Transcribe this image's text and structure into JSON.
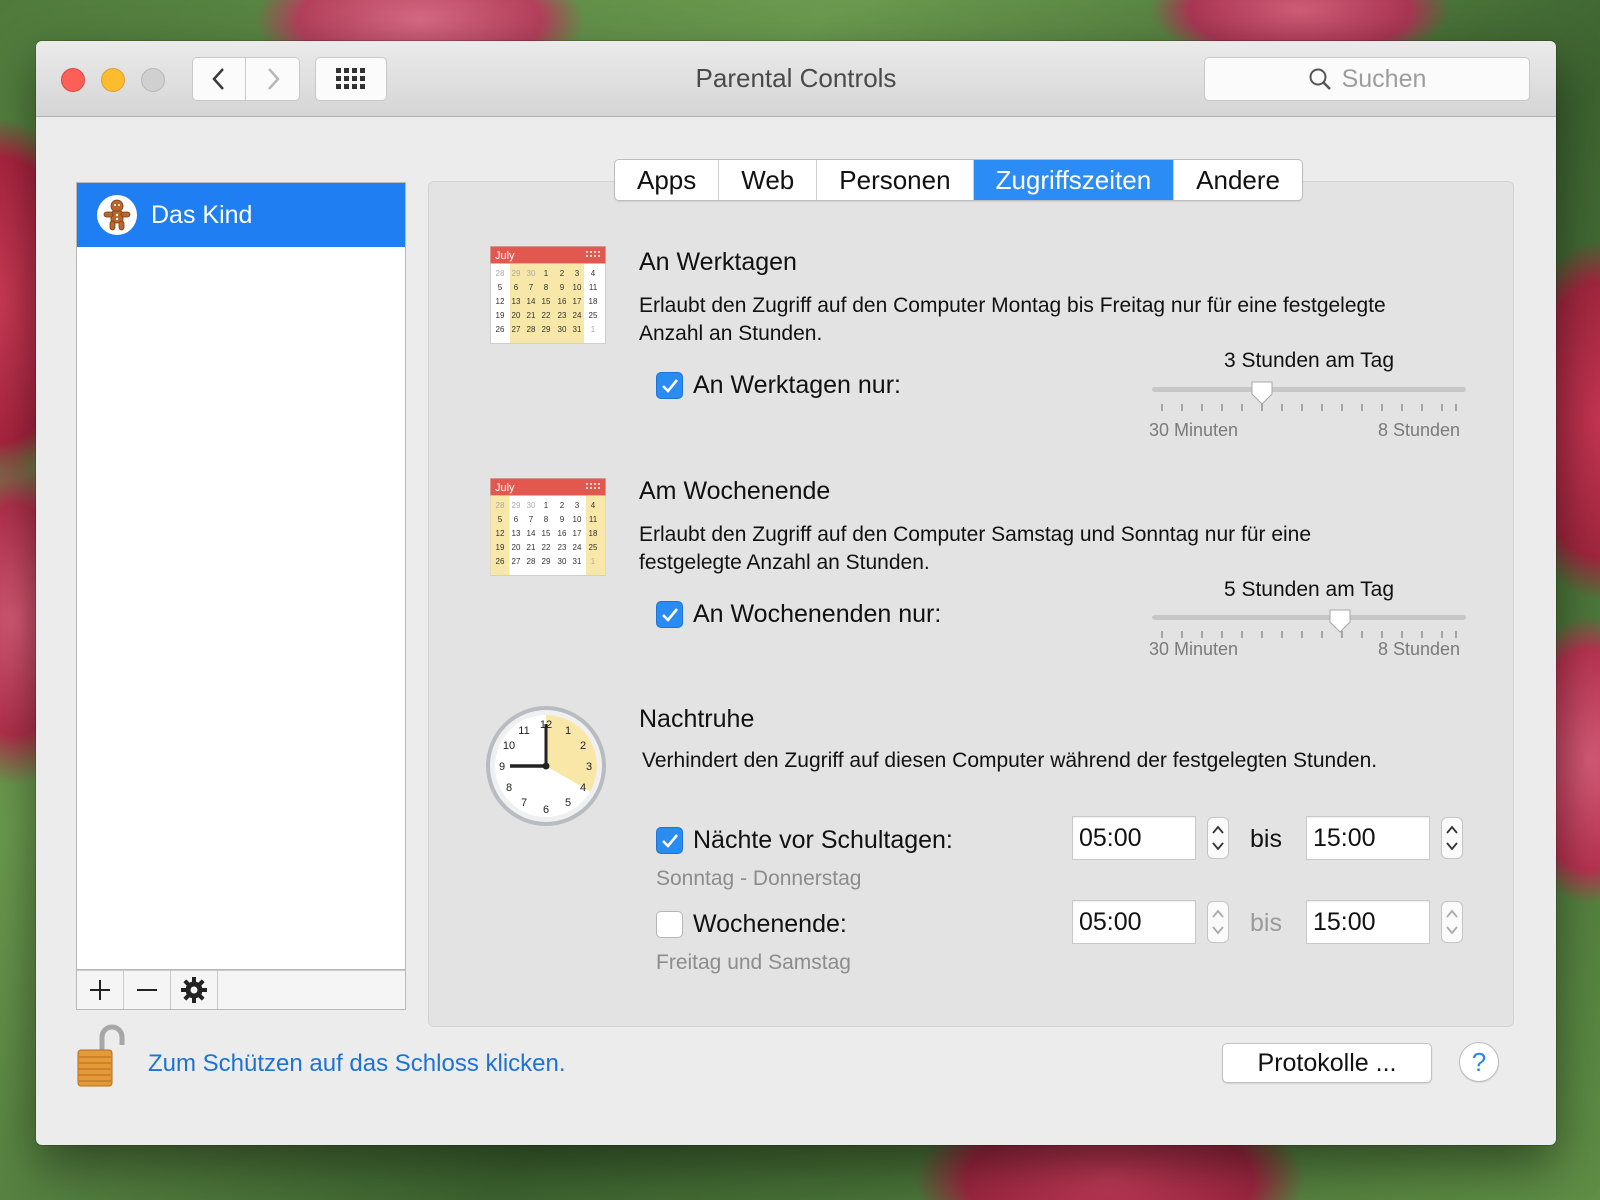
{
  "window": {
    "title": "Parental Controls"
  },
  "search": {
    "placeholder": "Suchen"
  },
  "sidebar": {
    "users": [
      {
        "name": "Das Kind"
      }
    ]
  },
  "tabs": [
    "Apps",
    "Web",
    "Personen",
    "Zugriffszeiten",
    "Andere"
  ],
  "active_tab": "Zugriffszeiten",
  "weekdays": {
    "title": "An Werktagen",
    "description_line1": "Erlaubt den Zugriff auf den Computer Montag bis Freitag nur für eine festgelegte",
    "description_line2": "Anzahl an Stunden.",
    "checkbox_label": "An Werktagen nur:",
    "checked": true,
    "slider_value_label": "3 Stunden am Tag",
    "slider_value_fraction": 0.35,
    "slider_min_label": "30 Minuten",
    "slider_max_label": "8 Stunden",
    "calendar_month": "July"
  },
  "weekend": {
    "title": "Am Wochenende",
    "description_line1": "Erlaubt den Zugriff auf den Computer Samstag und Sonntag nur für eine",
    "description_line2": "festgelegte Anzahl an Stunden.",
    "checkbox_label": "An Wochenenden nur:",
    "checked": true,
    "slider_value_label": "5 Stunden am Tag",
    "slider_value_fraction": 0.6,
    "slider_min_label": "30 Minuten",
    "slider_max_label": "8 Stunden",
    "calendar_month": "July"
  },
  "bedtime": {
    "title": "Nachtruhe",
    "description": "Verhindert den Zugriff auf diesen Computer während der festgelegten Stunden.",
    "school_nights": {
      "label": "Nächte vor Schultagen:",
      "checked": true,
      "days": "Sonntag - Donnerstag",
      "from": "05:00",
      "to": "15:00",
      "bis": "bis"
    },
    "weekend": {
      "label": "Wochenende:",
      "checked": false,
      "days": "Freitag und Samstag",
      "from": "05:00",
      "to": "15:00",
      "bis": "bis"
    }
  },
  "footer": {
    "lock_text": "Zum Schützen auf das Schloss klicken.",
    "logs_button": "Protokolle ...",
    "help_button": "?"
  },
  "colors": {
    "accent": "#2c8cf5",
    "selection": "#1f7ef1",
    "link": "#1d73d2"
  }
}
